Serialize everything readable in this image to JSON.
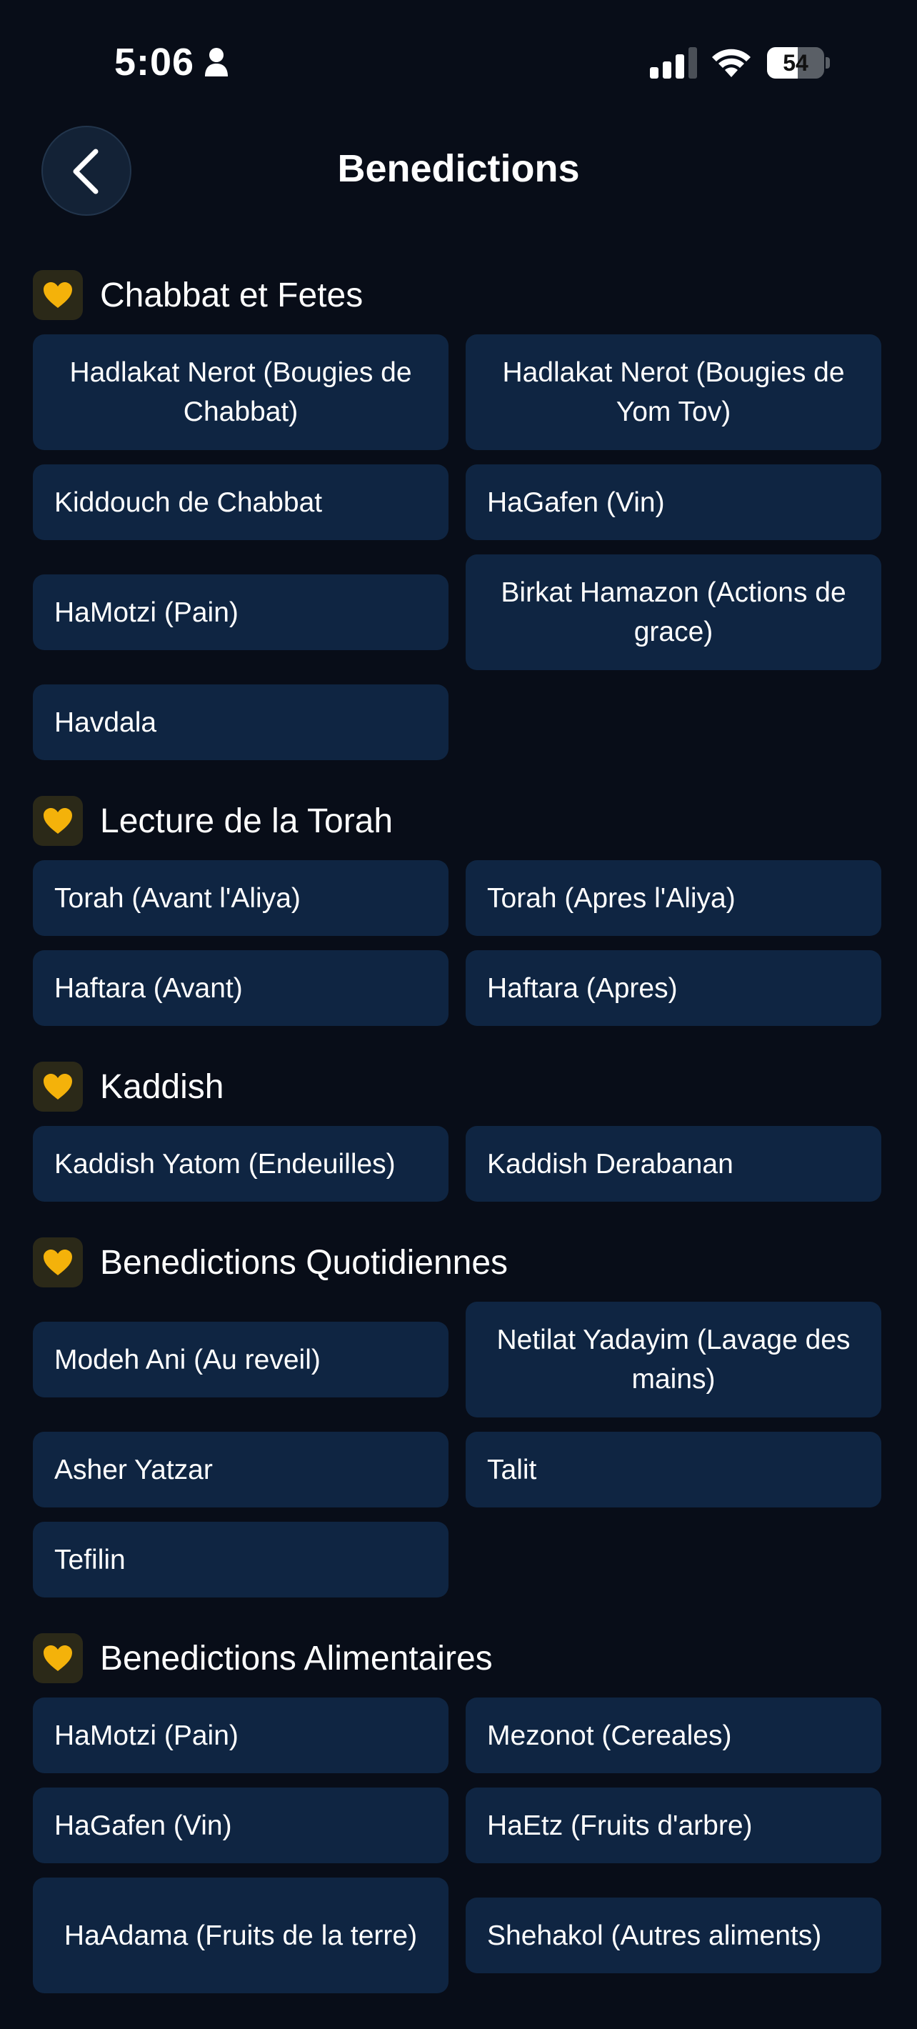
{
  "status": {
    "time": "5:06",
    "battery": "54",
    "battery_level": 0.54
  },
  "header": {
    "title": "Benedictions"
  },
  "icons": {
    "back": "chevron-left-icon",
    "section": "heart-icon"
  },
  "colors": {
    "background": "#080d18",
    "card": "#0f2542",
    "heart": "#f4b20a"
  },
  "sections": [
    {
      "title": "Chabbat et Fetes",
      "items": [
        "Hadlakat Nerot (Bougies de Chabbat)",
        "Hadlakat Nerot (Bougies de Yom Tov)",
        "Kiddouch de Chabbat",
        "HaGafen (Vin)",
        "HaMotzi (Pain)",
        "Birkat Hamazon (Actions de grace)",
        "Havdala"
      ]
    },
    {
      "title": "Lecture de la Torah",
      "items": [
        "Torah (Avant l'Aliya)",
        "Torah (Apres l'Aliya)",
        "Haftara (Avant)",
        "Haftara (Apres)"
      ]
    },
    {
      "title": "Kaddish",
      "items": [
        "Kaddish Yatom (Endeuilles)",
        "Kaddish Derabanan"
      ]
    },
    {
      "title": "Benedictions Quotidiennes",
      "items": [
        "Modeh Ani (Au reveil)",
        "Netilat Yadayim (Lavage des mains)",
        "Asher Yatzar",
        "Talit",
        "Tefilin"
      ]
    },
    {
      "title": "Benedictions Alimentaires",
      "items": [
        "HaMotzi (Pain)",
        "Mezonot (Cereales)",
        "HaGafen (Vin)",
        "HaEtz (Fruits d'arbre)",
        "HaAdama (Fruits de la terre)",
        "Shehakol (Autres aliments)"
      ]
    }
  ]
}
